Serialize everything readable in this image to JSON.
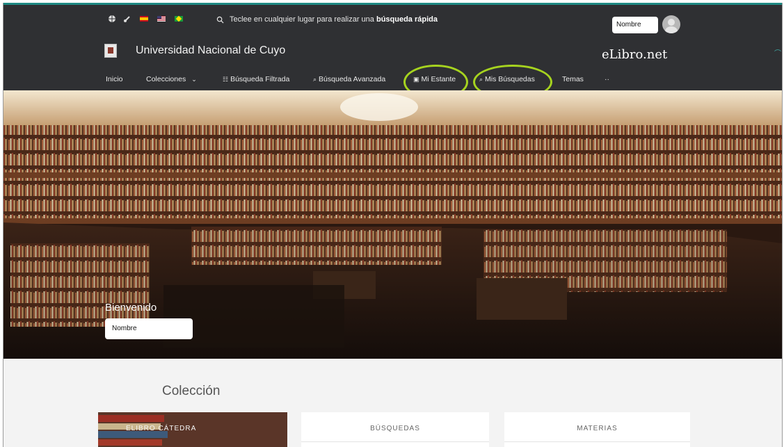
{
  "top_bar": {
    "search_text": "Teclee en cualquier lugar para realizar una",
    "search_text_bold": "búsqueda rápida",
    "user_name": "Nombre",
    "flag_icons": [
      "spain-flag-icon",
      "usa-flag-icon",
      "brazil-flag-icon"
    ]
  },
  "brand": {
    "institution": "Universidad Nacional de Cuyo",
    "elibro": "eLibro.net"
  },
  "nav": {
    "items": [
      {
        "label": "Inicio"
      },
      {
        "label": "Colecciones"
      },
      {
        "label": "Búsqueda Filtrada"
      },
      {
        "label": "Búsqueda Avanzada"
      },
      {
        "label": "Mi Estante"
      },
      {
        "label": "Mis Búsquedas"
      },
      {
        "label": "Temas"
      },
      {
        "label": "··"
      }
    ]
  },
  "hero": {
    "welcome": "Bienvenido",
    "name_value": "Nombre"
  },
  "collection": {
    "title": "Colección",
    "cards": [
      {
        "label": "ELIBRO CÁTEDRA"
      },
      {
        "label": "BÚSQUEDAS"
      },
      {
        "label": "MATERIAS"
      }
    ]
  },
  "colors": {
    "header_bg": "#2f3033",
    "highlight_circle": "#a6d31f",
    "accent": "#1f8a84"
  }
}
